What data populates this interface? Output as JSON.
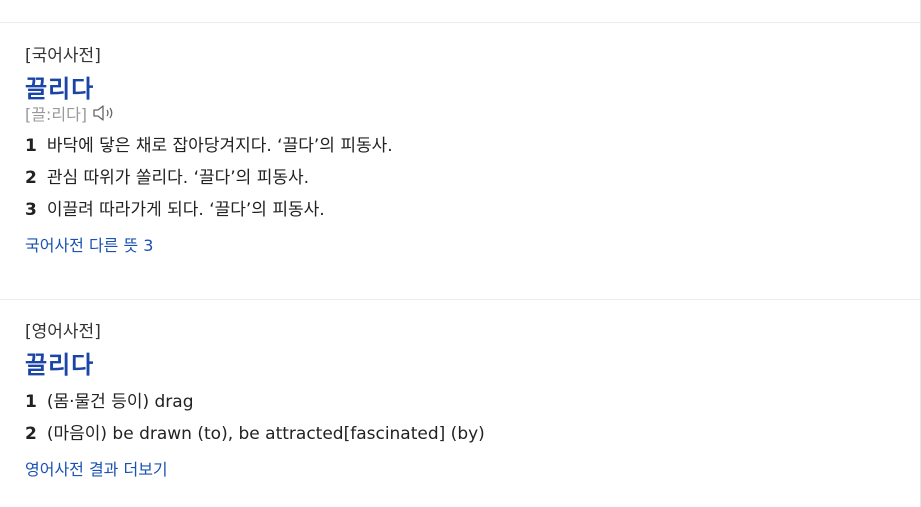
{
  "korean_dict": {
    "label": "[국어사전]",
    "word": "끌리다",
    "pronunciation": "[끌:리다]",
    "meanings": [
      {
        "num": "1",
        "text": "바닥에 닿은 채로 잡아당겨지다. ‘끌다’의 피동사."
      },
      {
        "num": "2",
        "text": "관심 따위가 쏠리다. ‘끌다’의 피동사."
      },
      {
        "num": "3",
        "text": "이끌려 따라가게 되다. ‘끌다’의 피동사."
      }
    ],
    "more_link": "국어사전 다른 뜻 3"
  },
  "english_dict": {
    "label": "[영어사전]",
    "word": "끌리다",
    "meanings": [
      {
        "num": "1",
        "text": "(몸·물건 등이) drag"
      },
      {
        "num": "2",
        "text": "(마음이) be drawn (to), be attracted[fascinated] (by)"
      }
    ],
    "more_link": "영어사전 결과 더보기"
  },
  "icons": {
    "speaker": "speaker-icon"
  },
  "colors": {
    "title": "#1a44a6",
    "link": "#1a51b4",
    "pronunciation": "#999999"
  }
}
